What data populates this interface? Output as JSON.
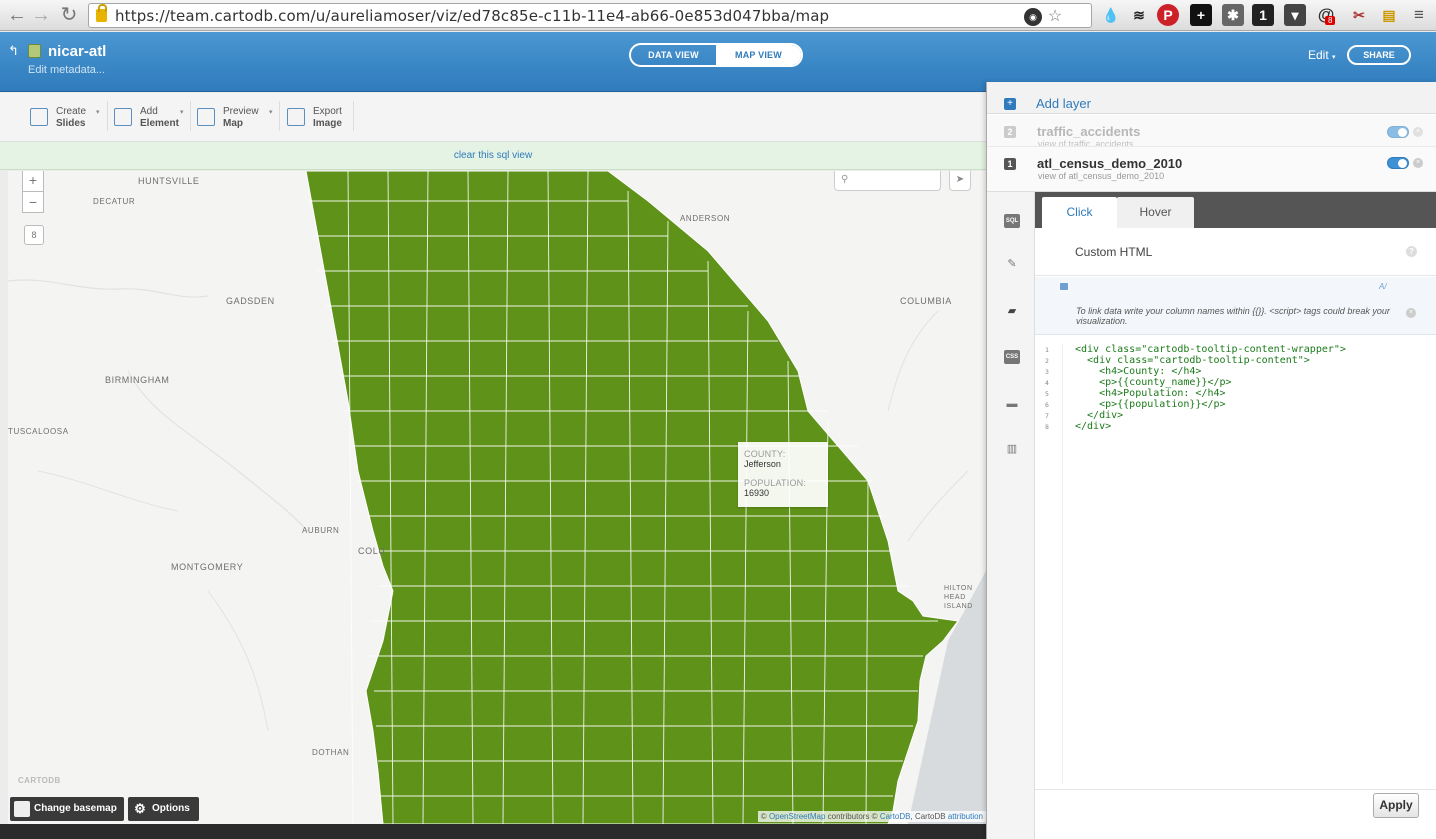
{
  "browser": {
    "url": "https://team.cartodb.com/u/aureliamoser/viz/ed78c85e-c11b-11e4-ab66-0e853d047bba/map",
    "extension_badges": [
      "8"
    ]
  },
  "header": {
    "title": "nicar-atl",
    "subtitle": "Edit metadata...",
    "tabs": [
      "DATA VIEW",
      "MAP VIEW"
    ],
    "active_tab": "MAP VIEW",
    "edit_label": "Edit",
    "share_label": "SHARE"
  },
  "toolbar": [
    {
      "line1": "Create",
      "line2": "Slides"
    },
    {
      "line1": "Add",
      "line2": "Element"
    },
    {
      "line1": "Preview",
      "line2": "Map"
    },
    {
      "line1": "Export",
      "line2": "Image"
    }
  ],
  "sql_bar": {
    "link": "clear this sql view"
  },
  "map": {
    "zoom_in": "+",
    "zoom_out": "−",
    "zoom_level": "8",
    "place_labels": [
      "HUNTSVILLE",
      "DECATUR",
      "GADSDEN",
      "BIRMINGHAM",
      "TUSCALOOSA",
      "AUBURN",
      "MONTGOMERY",
      "DOTHAN",
      "COLUMBIA",
      "ANDERSON",
      "COLU",
      "HILTON HEAD ISLAND"
    ],
    "fill_color": "#5f9218",
    "tooltip": {
      "county_label": "COUNTY:",
      "county_value": "Jefferson",
      "population_label": "POPULATION:",
      "population_value": "16930"
    },
    "logo": "CARTODB",
    "change_basemap": "Change basemap",
    "options": "Options",
    "attribution": {
      "prefix": "©",
      "osm": "OpenStreetMap",
      "mid": "contributors ©",
      "cartodb": "CartoDB",
      "tail": ", CartoDB",
      "attr": "attribution"
    }
  },
  "panel": {
    "add_layer": "Add layer",
    "layers": [
      {
        "number": "2",
        "name": "traffic_accidents",
        "subtitle": "view of traffic_accidents"
      },
      {
        "number": "1",
        "name": "atl_census_demo_2010",
        "subtitle": "view of atl_census_demo_2010"
      }
    ],
    "sidebar_icons": [
      "sql-icon",
      "wizard-icon",
      "infowindow-icon",
      "css-icon",
      "legend-icon",
      "chart-icon"
    ],
    "tabs": {
      "click": "Click",
      "hover": "Hover",
      "active": "Click"
    },
    "custom_html_label": "Custom HTML",
    "hint": "To link data write your column names within {{}}. <script> tags could break your visualization.",
    "code_lines": [
      "<div class=\"cartodb-tooltip-content-wrapper\">",
      "  <div class=\"cartodb-tooltip-content\">",
      "    <h4>County: </h4>",
      "    <p>{{county_name}}</p>",
      "    <h4>Population: </h4>",
      "    <p>{{population}}</p>",
      "  </div>",
      "</div>"
    ],
    "line_numbers": [
      "1",
      "2",
      "3",
      "4",
      "5",
      "6",
      "7",
      "8"
    ],
    "apply_label": "Apply"
  }
}
